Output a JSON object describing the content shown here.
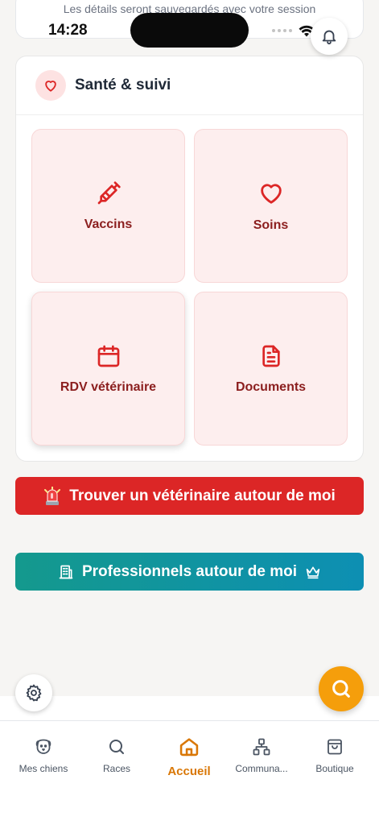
{
  "banner": {
    "message": "Les détails seront sauvegardés avec votre session"
  },
  "status_bar": {
    "time": "14:28"
  },
  "health": {
    "title": "Santé & suivi",
    "tiles": [
      {
        "label": "Vaccins",
        "icon": "syringe-icon"
      },
      {
        "label": "Soins",
        "icon": "heart-icon"
      },
      {
        "label": "RDV vétérinaire",
        "icon": "calendar-icon"
      },
      {
        "label": "Documents",
        "icon": "document-icon"
      }
    ]
  },
  "actions": {
    "find_vet": "Trouver un vétérinaire autour de moi",
    "professionals": "Professionnels autour de moi"
  },
  "tabs": [
    {
      "label": "Mes chiens",
      "icon": "dog-icon"
    },
    {
      "label": "Races",
      "icon": "search-icon"
    },
    {
      "label": "Accueil",
      "icon": "home-icon",
      "active": true
    },
    {
      "label": "Communa...",
      "icon": "network-icon"
    },
    {
      "label": "Boutique",
      "icon": "shopping-bag-icon"
    }
  ],
  "colors": {
    "accent": "#f59e0b",
    "danger": "#dc2626",
    "tile_bg": "#fdeeee",
    "tile_text": "#8b1e1e",
    "teal_start": "#14998d",
    "teal_end": "#0d8fb3"
  }
}
